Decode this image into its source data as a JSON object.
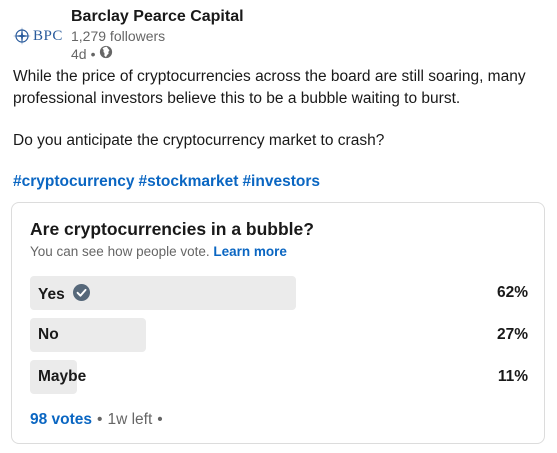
{
  "author": {
    "logo_text": "BPC",
    "name": "Barclay Pearce Capital",
    "followers": "1,279 followers",
    "age": "4d",
    "separator": "•",
    "visibility_icon": "globe-icon"
  },
  "post": {
    "paragraph_1": "While the price of cryptocurrencies across the board are still soaring, many professional investors believe this to be a bubble waiting to burst.",
    "paragraph_2": "Do you anticipate the cryptocurrency market to crash?",
    "hashtags": [
      "#cryptocurrency",
      "#stockmarket",
      "#investors"
    ]
  },
  "poll": {
    "question": "Are cryptocurrencies in a bubble?",
    "note": "You can see how people vote.",
    "learn_more": "Learn more",
    "options": [
      {
        "label": "Yes",
        "percent_text": "62%",
        "fraction": 0.62,
        "selected": true
      },
      {
        "label": "No",
        "percent_text": "27%",
        "fraction": 0.27,
        "selected": false
      },
      {
        "label": "Maybe",
        "percent_text": "11%",
        "fraction": 0.11,
        "selected": false
      }
    ],
    "votes": "98 votes",
    "separator": "•",
    "time_left": "1w left",
    "trailing_separator": "•"
  },
  "colors": {
    "link": "#0a66c2",
    "bar": "#ebebeb",
    "check": "#56687a"
  }
}
